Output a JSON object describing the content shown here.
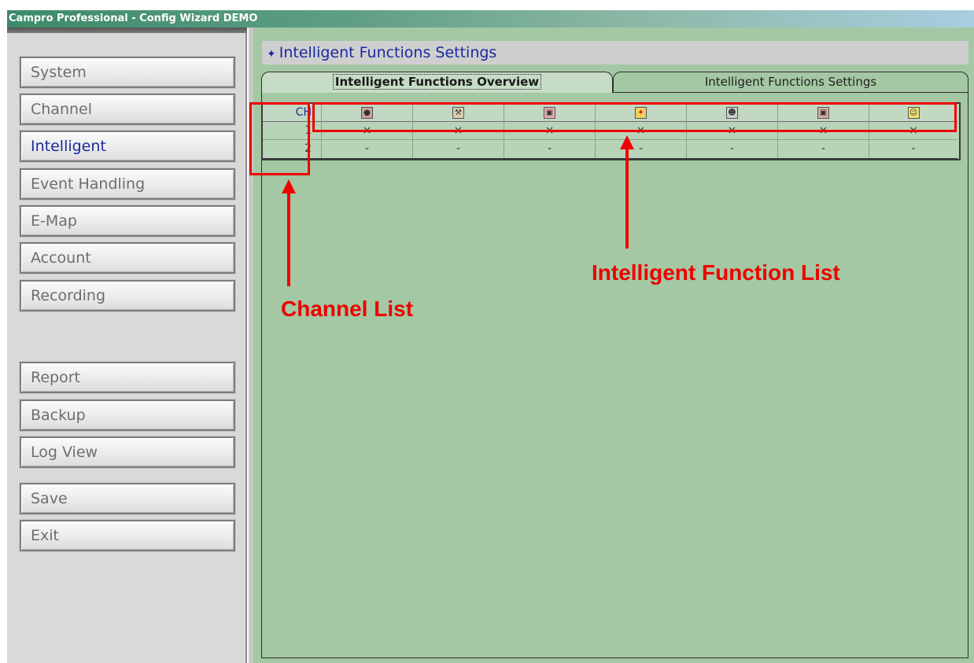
{
  "window": {
    "title": "Campro Professional - Config Wizard DEMO"
  },
  "sidebar": {
    "items": [
      {
        "label": "System"
      },
      {
        "label": "Channel"
      },
      {
        "label": "Intelligent",
        "active": true
      },
      {
        "label": "Event Handling"
      },
      {
        "label": "E-Map"
      },
      {
        "label": "Account"
      },
      {
        "label": "Recording"
      },
      {
        "label": "Report"
      },
      {
        "label": "Backup"
      },
      {
        "label": "Log View"
      },
      {
        "label": "Save"
      },
      {
        "label": "Exit"
      }
    ]
  },
  "main": {
    "header_icon": "settings-emblem-icon",
    "header_title": "Intelligent Functions Settings",
    "tabs": [
      {
        "label": "Intelligent Functions Overview",
        "selected": true
      },
      {
        "label": "Intelligent Functions Settings",
        "selected": false
      }
    ],
    "table": {
      "ch_header": "CH",
      "function_icons": [
        "person-detection-icon",
        "tamper-detection-icon",
        "object-detection-icon",
        "intrusion-detection-icon",
        "face-detection-icon",
        "missing-object-icon",
        "smile-detection-icon"
      ],
      "rows": [
        {
          "ch": "1",
          "cells": [
            "×",
            "×",
            "×",
            "×",
            "×",
            "×",
            "×"
          ]
        },
        {
          "ch": "2",
          "cells": [
            "-",
            "-",
            "-",
            "-",
            "-",
            "-",
            "-"
          ]
        }
      ]
    }
  },
  "annotations": {
    "channel_list": "Channel List",
    "function_list": "Intelligent Function List",
    "color": "#ee0000"
  },
  "colors": {
    "main_background": "#a3c8a3",
    "header_text": "#1a2aa0",
    "sidebar_background": "#d9d9d9"
  }
}
